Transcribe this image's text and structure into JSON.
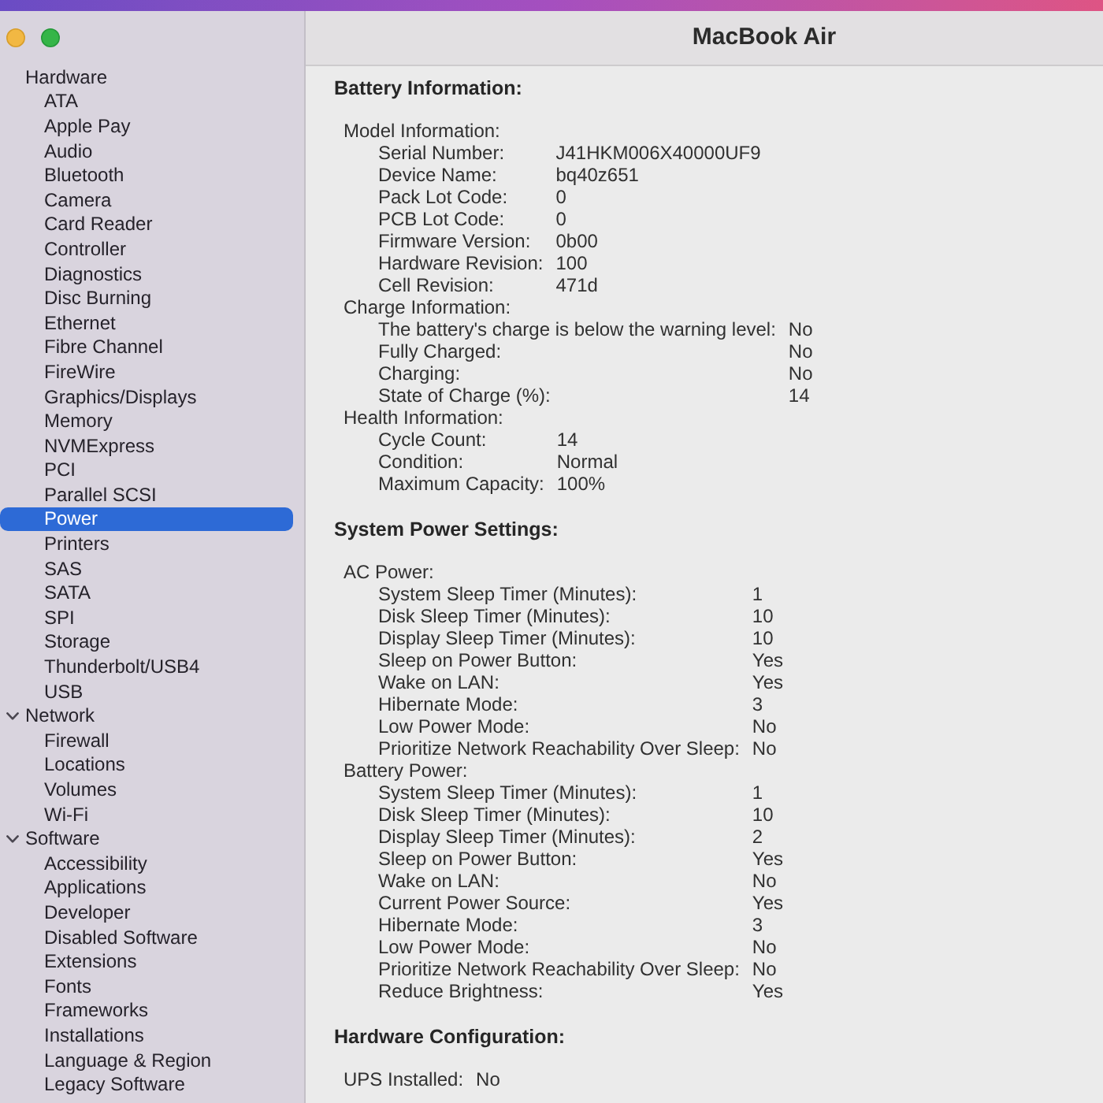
{
  "window": {
    "title": "MacBook Air"
  },
  "sidebar": {
    "items": [
      {
        "label": "Hardware",
        "selected": false,
        "children": [
          {
            "label": "ATA",
            "selected": false
          },
          {
            "label": "Apple Pay",
            "selected": false
          },
          {
            "label": "Audio",
            "selected": false
          },
          {
            "label": "Bluetooth",
            "selected": false
          },
          {
            "label": "Camera",
            "selected": false
          },
          {
            "label": "Card Reader",
            "selected": false
          },
          {
            "label": "Controller",
            "selected": false
          },
          {
            "label": "Diagnostics",
            "selected": false
          },
          {
            "label": "Disc Burning",
            "selected": false
          },
          {
            "label": "Ethernet",
            "selected": false
          },
          {
            "label": "Fibre Channel",
            "selected": false
          },
          {
            "label": "FireWire",
            "selected": false
          },
          {
            "label": "Graphics/Displays",
            "selected": false
          },
          {
            "label": "Memory",
            "selected": false
          },
          {
            "label": "NVMExpress",
            "selected": false
          },
          {
            "label": "PCI",
            "selected": false
          },
          {
            "label": "Parallel SCSI",
            "selected": false
          },
          {
            "label": "Power",
            "selected": true
          },
          {
            "label": "Printers",
            "selected": false
          },
          {
            "label": "SAS",
            "selected": false
          },
          {
            "label": "SATA",
            "selected": false
          },
          {
            "label": "SPI",
            "selected": false
          },
          {
            "label": "Storage",
            "selected": false
          },
          {
            "label": "Thunderbolt/USB4",
            "selected": false
          },
          {
            "label": "USB",
            "selected": false
          }
        ]
      },
      {
        "label": "Network",
        "selected": false,
        "expanded": true,
        "children": [
          {
            "label": "Firewall",
            "selected": false
          },
          {
            "label": "Locations",
            "selected": false
          },
          {
            "label": "Volumes",
            "selected": false
          },
          {
            "label": "Wi-Fi",
            "selected": false
          }
        ]
      },
      {
        "label": "Software",
        "selected": false,
        "expanded": true,
        "children": [
          {
            "label": "Accessibility",
            "selected": false
          },
          {
            "label": "Applications",
            "selected": false
          },
          {
            "label": "Developer",
            "selected": false
          },
          {
            "label": "Disabled Software",
            "selected": false
          },
          {
            "label": "Extensions",
            "selected": false
          },
          {
            "label": "Fonts",
            "selected": false
          },
          {
            "label": "Frameworks",
            "selected": false
          },
          {
            "label": "Installations",
            "selected": false
          },
          {
            "label": "Language & Region",
            "selected": false
          },
          {
            "label": "Legacy Software",
            "selected": false
          }
        ]
      }
    ]
  },
  "content": {
    "sections": [
      {
        "title": "Battery Information:",
        "groups": [
          {
            "title": "Model Information:",
            "rows": [
              {
                "label": "Serial Number:",
                "value": "J41HKM006X40000UF9"
              },
              {
                "label": "Device Name:",
                "value": "bq40z651"
              },
              {
                "label": "Pack Lot Code:",
                "value": "0"
              },
              {
                "label": "PCB Lot Code:",
                "value": "0"
              },
              {
                "label": "Firmware Version:",
                "value": "0b00"
              },
              {
                "label": "Hardware Revision:",
                "value": "100"
              },
              {
                "label": "Cell Revision:",
                "value": "471d"
              }
            ]
          },
          {
            "title": "Charge Information:",
            "rows": [
              {
                "label": "The battery's charge is below the warning level:",
                "value": "No"
              },
              {
                "label": "Fully Charged:",
                "value": "No"
              },
              {
                "label": "Charging:",
                "value": "No"
              },
              {
                "label": "State of Charge (%):",
                "value": "14"
              }
            ]
          },
          {
            "title": "Health Information:",
            "rows": [
              {
                "label": "Cycle Count:",
                "value": "14"
              },
              {
                "label": "Condition:",
                "value": "Normal"
              },
              {
                "label": "Maximum Capacity:",
                "value": "100%"
              }
            ]
          }
        ]
      },
      {
        "title": "System Power Settings:",
        "groups": [
          {
            "title": "AC Power:",
            "rows": [
              {
                "label": "System Sleep Timer (Minutes):",
                "value": "1"
              },
              {
                "label": "Disk Sleep Timer (Minutes):",
                "value": "10"
              },
              {
                "label": "Display Sleep Timer (Minutes):",
                "value": "10"
              },
              {
                "label": "Sleep on Power Button:",
                "value": "Yes"
              },
              {
                "label": "Wake on LAN:",
                "value": "Yes"
              },
              {
                "label": "Hibernate Mode:",
                "value": "3"
              },
              {
                "label": "Low Power Mode:",
                "value": "No"
              },
              {
                "label": "Prioritize Network Reachability Over Sleep:",
                "value": "No"
              }
            ]
          },
          {
            "title": "Battery Power:",
            "rows": [
              {
                "label": "System Sleep Timer (Minutes):",
                "value": "1"
              },
              {
                "label": "Disk Sleep Timer (Minutes):",
                "value": "10"
              },
              {
                "label": "Display Sleep Timer (Minutes):",
                "value": "2"
              },
              {
                "label": "Sleep on Power Button:",
                "value": "Yes"
              },
              {
                "label": "Wake on LAN:",
                "value": "No"
              },
              {
                "label": "Current Power Source:",
                "value": "Yes"
              },
              {
                "label": "Hibernate Mode:",
                "value": "3"
              },
              {
                "label": "Low Power Mode:",
                "value": "No"
              },
              {
                "label": "Prioritize Network Reachability Over Sleep:",
                "value": "No"
              },
              {
                "label": "Reduce Brightness:",
                "value": "Yes"
              }
            ]
          }
        ]
      },
      {
        "title": "Hardware Configuration:",
        "groups": [
          {
            "rows": [
              {
                "label": "UPS Installed:",
                "value": "No"
              }
            ]
          }
        ]
      }
    ]
  }
}
